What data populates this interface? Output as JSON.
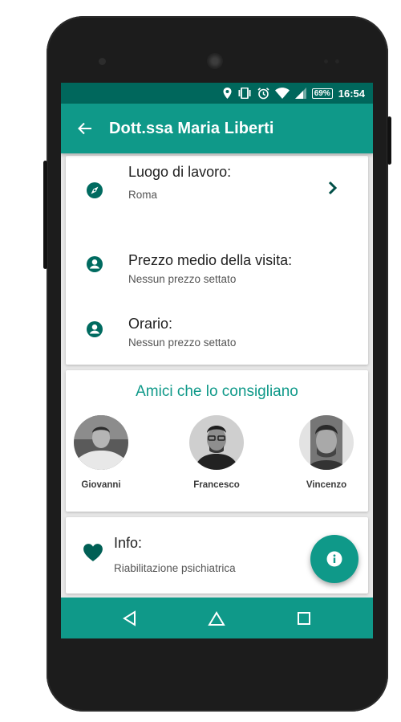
{
  "statusbar": {
    "battery": "69%",
    "time": "16:54",
    "icons": [
      "location-icon",
      "vibrate-icon",
      "alarm-icon",
      "wifi-icon",
      "signal-icon",
      "battery-icon"
    ]
  },
  "appbar": {
    "back_icon": "arrow-left-icon",
    "title": "Dott.ssa Maria Liberti"
  },
  "details": {
    "workplace": {
      "icon": "compass-icon",
      "title": "Luogo di lavoro:",
      "value": "Roma",
      "action_icon": "chevron-right-icon"
    },
    "price": {
      "icon": "account-circle-icon",
      "title": "Prezzo medio della visita:",
      "value": "Nessun prezzo settato"
    },
    "hours": {
      "icon": "account-circle-icon",
      "title": "Orario:",
      "value": "Nessun prezzo settato"
    }
  },
  "friends": {
    "title": "Amici che lo consigliano",
    "people": [
      {
        "name": "Giovanni"
      },
      {
        "name": "Francesco"
      },
      {
        "name": "Vincenzo"
      }
    ]
  },
  "info": {
    "icon": "heart-icon",
    "title": "Info:",
    "value": "Riabilitazione psichiatrica"
  },
  "fab": {
    "icon": "info-icon"
  },
  "navbar": {
    "icons": [
      "back-triangle-icon",
      "home-icon",
      "recents-square-icon"
    ]
  },
  "colors": {
    "primary": "#0f9989",
    "primary_dark": "#00675c",
    "icon_dark": "#006b60",
    "background": "#e7e7e7"
  }
}
